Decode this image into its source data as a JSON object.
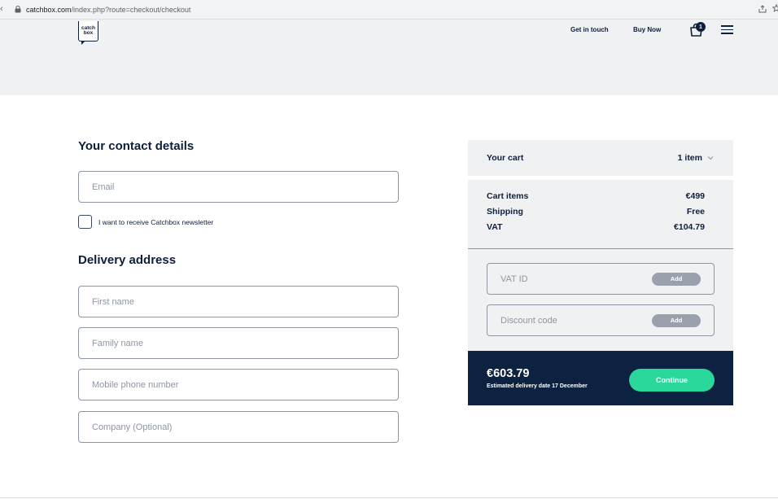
{
  "browser": {
    "back_glyph": "‹",
    "url_host": "catchbox.com",
    "url_path": "/index.php?route=checkout/checkout"
  },
  "header": {
    "logo_line1": "catch",
    "logo_line2": "box",
    "nav": {
      "get_in_touch": "Get in touch",
      "buy_now": "Buy Now"
    },
    "cart_badge": "1"
  },
  "contact": {
    "heading": "Your contact details",
    "email_placeholder": "Email",
    "newsletter_label": "I want to receive Catchbox newsletter"
  },
  "delivery": {
    "heading": "Delivery address",
    "first_name_placeholder": "First name",
    "family_name_placeholder": "Family name",
    "mobile_placeholder": "Mobile phone number",
    "company_placeholder": "Company (Optional)"
  },
  "cart": {
    "title": "Your cart",
    "count": "1 item",
    "summary": [
      {
        "label": "Cart items",
        "value": "€499"
      },
      {
        "label": "Shipping",
        "value": "Free"
      },
      {
        "label": "VAT",
        "value": "€104.79"
      }
    ],
    "vat_id_placeholder": "VAT ID",
    "discount_placeholder": "Discount code",
    "add_label": "Add",
    "total": "€603.79",
    "delivery_estimate": "Estimated delivery date 17 December",
    "continue_label": "Continue"
  },
  "colors": {
    "navy": "#0d1f3c",
    "panel_grey": "#f0f1f2",
    "accent_green": "#2ad89b",
    "total_bg": "#0d2241"
  }
}
